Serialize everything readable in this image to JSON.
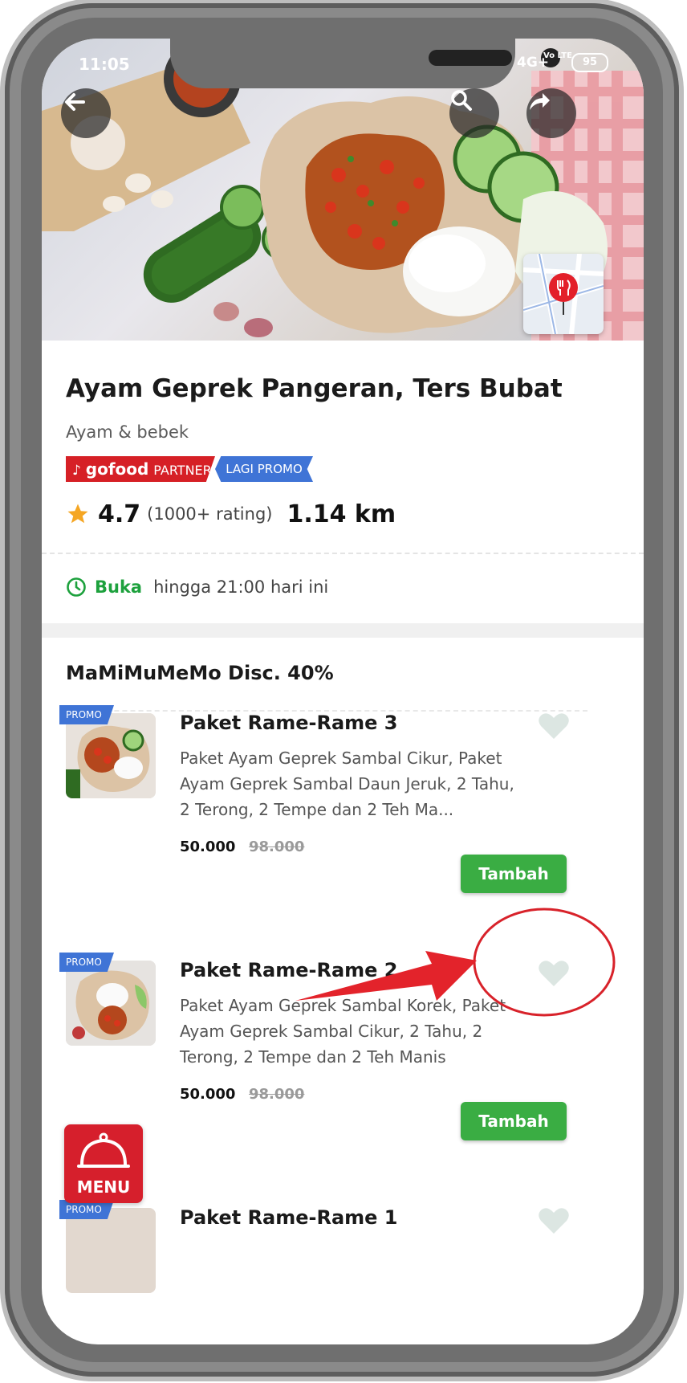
{
  "status_bar": {
    "time": "11:05",
    "network": "4G+",
    "volte": "Vo LTE",
    "battery": "95"
  },
  "header": {
    "back_icon": "back-arrow-icon",
    "search_icon": "search-icon",
    "share_icon": "share-icon",
    "map_icon": "restaurant-pin-icon"
  },
  "restaurant": {
    "name": "Ayam Geprek Pangeran, Ters Bubat",
    "category": "Ayam & bebek",
    "badge_partner_logo": "gofood",
    "badge_partner_text": "PARTNER",
    "badge_promo": "LAGI PROMO",
    "rating": "4.7",
    "rating_count": "(1000+ rating)",
    "distance": "1.14 km",
    "open_status": "Buka",
    "open_hours": "hingga 21:00 hari ini"
  },
  "section": {
    "title": "MaMiMuMeMo Disc. 40%"
  },
  "items": [
    {
      "promo": "PROMO",
      "name": "Paket Rame-Rame 3",
      "desc": "Paket Ayam Geprek Sambal Cikur, Paket Ayam Geprek Sambal Daun Jeruk, 2 Tahu, 2 Terong, 2 Tempe dan 2 Teh Ma...",
      "price": "50.000",
      "price_old": "98.000",
      "button": "Tambah"
    },
    {
      "promo": "PROMO",
      "name": "Paket Rame-Rame 2",
      "desc": "Paket Ayam Geprek Sambal Korek, Paket Ayam Geprek Sambal Cikur, 2 Tahu, 2 Terong, 2 Tempe dan 2 Teh Manis",
      "price": "50.000",
      "price_old": "98.000",
      "button": "Tambah"
    },
    {
      "promo": "PROMO",
      "name": "Paket Rame-Rame 1"
    }
  ],
  "menu_button": "MENU",
  "colors": {
    "green": "#3aad43",
    "red": "#d62026",
    "blue": "#3f74d6",
    "star": "#f5a623"
  }
}
